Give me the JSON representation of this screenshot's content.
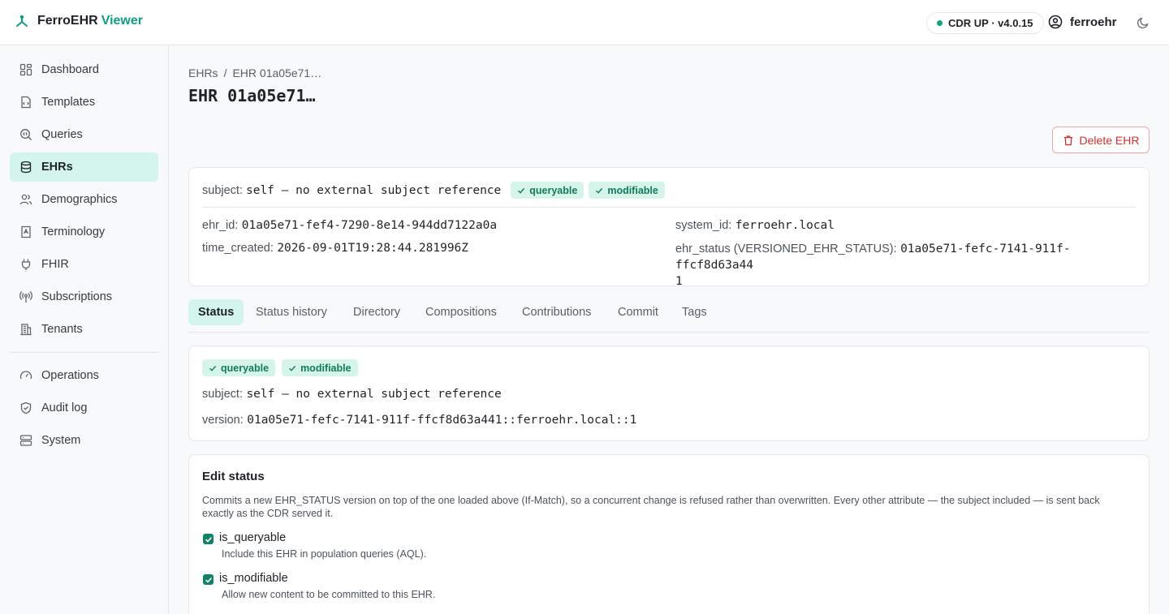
{
  "header": {
    "brand_main": "FerroEHR",
    "brand_accent": "Viewer",
    "cdr_status": "CDR UP · v4.0.15",
    "username": "ferroehr"
  },
  "sidebar": {
    "items": [
      {
        "label": "Dashboard",
        "icon": "dashboard-icon"
      },
      {
        "label": "Templates",
        "icon": "template-icon"
      },
      {
        "label": "Queries",
        "icon": "query-icon"
      },
      {
        "label": "EHRs",
        "icon": "database-icon",
        "active": true
      },
      {
        "label": "Demographics",
        "icon": "users-icon"
      },
      {
        "label": "Terminology",
        "icon": "book-icon"
      },
      {
        "label": "FHIR",
        "icon": "plug-icon"
      },
      {
        "label": "Subscriptions",
        "icon": "broadcast-icon"
      },
      {
        "label": "Tenants",
        "icon": "building-icon"
      },
      {
        "label": "Operations",
        "icon": "gauge-icon"
      },
      {
        "label": "Audit log",
        "icon": "shield-icon"
      },
      {
        "label": "System",
        "icon": "server-icon"
      }
    ]
  },
  "breadcrumb": {
    "root": "EHRs",
    "sep": "/",
    "current": "EHR 01a05e71…"
  },
  "page_title": "EHR 01a05e71…",
  "delete_label": "Delete EHR",
  "summary": {
    "subject_label": "subject:",
    "subject_value": "self — no external subject reference",
    "badge_queryable": "queryable",
    "badge_modifiable": "modifiable",
    "ehr_id_label": "ehr_id:",
    "ehr_id_value": "01a05e71-fef4-7290-8e14-944dd7122a0a",
    "system_id_label": "system_id:",
    "system_id_value": "ferroehr.local",
    "time_created_label": "time_created:",
    "time_created_value": "2026-09-01T19:28:44.281996Z",
    "ehr_status_label": "ehr_status (VERSIONED_EHR_STATUS):",
    "ehr_status_value_1": "01a05e71-fefc-7141-911f-ffcf8d63a44",
    "ehr_status_value_2": "1"
  },
  "tabs": [
    "Status",
    "Status history",
    "Directory",
    "Compositions",
    "Contributions",
    "Commit",
    "Tags"
  ],
  "status_card": {
    "badge_queryable": "queryable",
    "badge_modifiable": "modifiable",
    "subject_label": "subject:",
    "subject_value": "self — no external subject reference",
    "version_label": "version:",
    "version_value": "01a05e71-fefc-7141-911f-ffcf8d63a441::ferroehr.local::1"
  },
  "edit_status": {
    "title": "Edit status",
    "description_1": "Commits a new EHR_STATUS version on top of the one loaded above (If-Match), so a concurrent change is refused rather than overwritten. Every other attribute — the subject included — is sent back",
    "description_2": "exactly as the CDR served it.",
    "is_queryable_label": "is_queryable",
    "is_queryable_help": "Include this EHR in population queries (AQL).",
    "is_modifiable_label": "is_modifiable",
    "is_modifiable_help": "Allow new content to be committed to this EHR."
  },
  "colors": {
    "accent": "#0f9b84",
    "active_bg": "#d3f5ec",
    "danger": "#d12d2d",
    "badge_bg": "#d6f5ea"
  }
}
